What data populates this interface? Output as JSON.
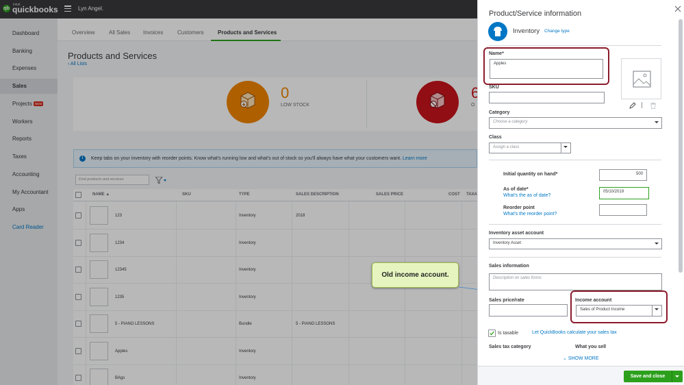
{
  "topbar": {
    "logo_small": "intuit",
    "logo_text": "quickbooks",
    "company_name": "Lyn Angel."
  },
  "sidebar": {
    "items": [
      {
        "label": "Dashboard"
      },
      {
        "label": "Banking"
      },
      {
        "label": "Expenses"
      },
      {
        "label": "Sales"
      },
      {
        "label": "Projects",
        "badge": "NEW"
      },
      {
        "label": "Workers"
      },
      {
        "label": "Reports"
      },
      {
        "label": "Taxes"
      },
      {
        "label": "Accounting"
      },
      {
        "label": "My Accountant"
      },
      {
        "label": "Apps"
      },
      {
        "label": "Card Reader"
      }
    ]
  },
  "subnav": {
    "tabs": [
      {
        "label": "Overview"
      },
      {
        "label": "All Sales"
      },
      {
        "label": "Invoices"
      },
      {
        "label": "Customers"
      },
      {
        "label": "Products and Services"
      }
    ]
  },
  "page": {
    "title": "Products and Services",
    "all_lists_link": "‹ All Lists"
  },
  "summary": {
    "low_stock_count": "0",
    "low_stock_label": "LOW STOCK",
    "out_of_stock_count": "6",
    "out_of_stock_label": "O"
  },
  "banner": {
    "text": "Keep tabs on your inventory with reorder points. Know what's running low and what's out of stock so you'll always have what your customers want.",
    "link": "Learn more"
  },
  "search": {
    "placeholder": "Find products and services"
  },
  "table": {
    "headers": [
      "NAME ▲",
      "SKU",
      "TYPE",
      "SALES DESCRIPTION",
      "SALES PRICE",
      "COST",
      "TAXA"
    ],
    "rows": [
      {
        "name": "123",
        "type": "Inventory",
        "desc": "2018"
      },
      {
        "name": "1234",
        "type": "Inventory",
        "desc": ""
      },
      {
        "name": "12345",
        "type": "Inventory",
        "desc": ""
      },
      {
        "name": "1235",
        "type": "Inventory",
        "desc": ""
      },
      {
        "name": "5 - PIANO LESSONS",
        "type": "Bundle",
        "desc": "5 - PIANO LESSONS"
      },
      {
        "name": "Apples",
        "type": "Inventory",
        "desc": ""
      },
      {
        "name": "BAgs",
        "type": "Inventory",
        "desc": ""
      }
    ]
  },
  "callout": {
    "text": "Old income account."
  },
  "drawer": {
    "title": "Product/Service information",
    "type_label": "Inventory",
    "change_type": "Change type",
    "name_label": "Name*",
    "name_value": "Apples",
    "sku_label": "SKU",
    "category_label": "Category",
    "category_placeholder": "Choose a category",
    "class_label": "Class",
    "class_placeholder": "Assign a class",
    "initial_qty_label": "Initial quantity on hand*",
    "initial_qty_value": "500",
    "as_of_label": "As of date*",
    "as_of_link": "What's the as of date?",
    "as_of_value": "05/10/2019",
    "reorder_label": "Reorder point",
    "reorder_link": "What's the reorder point?",
    "inventory_asset_label": "Inventory asset account",
    "inventory_asset_value": "Inventory Asset",
    "sales_info_label": "Sales information",
    "sales_desc_placeholder": "Description on sales forms",
    "sales_price_label": "Sales price/rate",
    "income_account_label": "Income account",
    "income_account_value": "Sales of Product Income",
    "is_taxable_label": "Is taxable",
    "tax_link": "Let QuickBooks calculate your sales tax",
    "sales_tax_category_label": "Sales tax category",
    "what_you_sell_label": "What you sell",
    "show_more": "SHOW MORE",
    "save_label": "Save and close"
  },
  "colors": {
    "brand_green": "#2ca01c",
    "link_blue": "#0077c5",
    "highlight": "#8b1a2b",
    "callout_bg": "#e6f5c0"
  }
}
